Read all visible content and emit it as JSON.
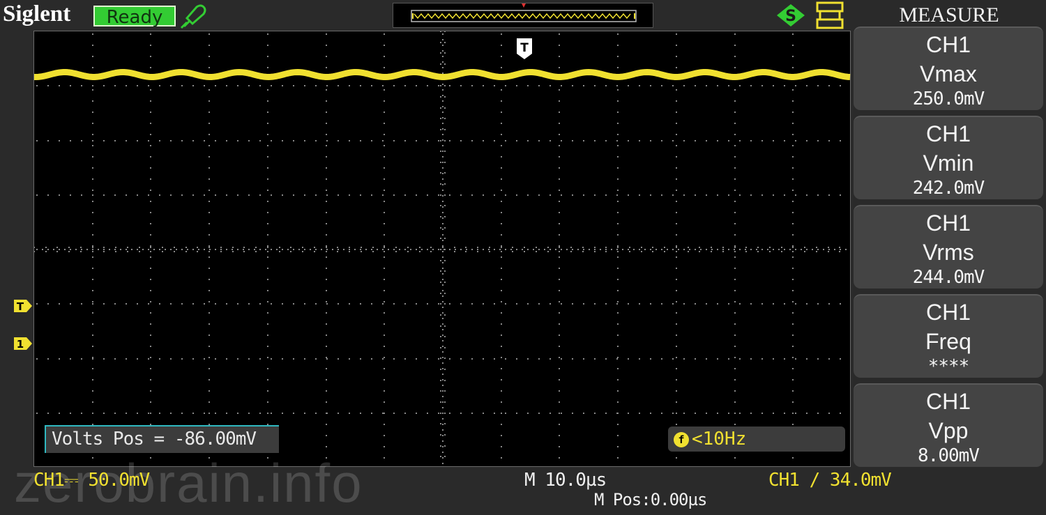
{
  "header": {
    "brand": "Siglent",
    "status": "Ready"
  },
  "colors": {
    "trace": "#f0e030",
    "status_bg": "#33cc33",
    "accent": "#2fb8c0"
  },
  "icons": {
    "probe": "probe-icon",
    "lock": "usb-lock-icon",
    "trigger": "trigger-status-icon",
    "trigger_marker": "trigger-marker-icon",
    "channel_marker": "channel-marker-icon"
  },
  "markers": {
    "trigger_top": "T",
    "trigger_level": "T",
    "channel": "1"
  },
  "overlay": {
    "volts_pos": "Volts Pos = -86.00mV",
    "freq_symbol": "f",
    "freq": "<10Hz"
  },
  "footer": {
    "ch1_scale": "CH1⎓ 50.0mV",
    "timebase": "M 10.0µs",
    "mpos": "M Pos:0.00µs",
    "trigger": "CH1 ∕ 34.0mV",
    "watermark": "zerobrain.info"
  },
  "menu": {
    "title": "MEASURE",
    "items": [
      {
        "channel": "CH1",
        "param": "Vmax",
        "value": "250.0mV"
      },
      {
        "channel": "CH1",
        "param": "Vmin",
        "value": "242.0mV"
      },
      {
        "channel": "CH1",
        "param": "Vrms",
        "value": "244.0mV"
      },
      {
        "channel": "CH1",
        "param": "Freq",
        "value": "****"
      },
      {
        "channel": "CH1",
        "param": "Vpp",
        "value": "8.00mV"
      }
    ]
  }
}
